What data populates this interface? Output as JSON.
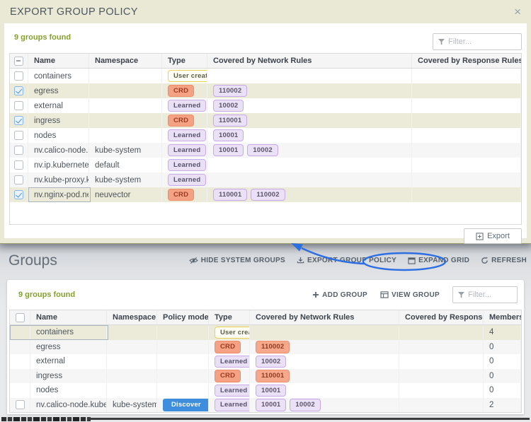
{
  "colors": {
    "accent_blue": "#2d6fe3",
    "selected_row": "#ecebd9",
    "modal_khaki": "#e9e9d6",
    "green_text": "#84a12e",
    "crd_badge": "#f5a284",
    "learned_badge": "#e9e0f5",
    "discover_badge": "#3e8edd"
  },
  "modal": {
    "title": "EXPORT GROUP POLICY",
    "close_icon": "×",
    "count_text": "9 groups found",
    "filter_placeholder": "Filter...",
    "export_button": "Export",
    "table": {
      "columns": [
        "Name",
        "Namespace",
        "Type",
        "Covered by Network Rules",
        "Covered by Response Rules"
      ],
      "rows": [
        {
          "name": "containers",
          "namespace": "",
          "type": "User created",
          "type_variant": "user",
          "rules": [],
          "rules_variant": "purple",
          "checkbox": "unchecked",
          "selected": false,
          "focus": false
        },
        {
          "name": "egress",
          "namespace": "",
          "type": "CRD",
          "type_variant": "crd",
          "rules": [
            "110002"
          ],
          "rules_variant": "purple",
          "checkbox": "checked",
          "selected": true,
          "focus": false
        },
        {
          "name": "external",
          "namespace": "",
          "type": "Learned",
          "type_variant": "learned",
          "rules": [
            "10002"
          ],
          "rules_variant": "purple",
          "checkbox": "unchecked",
          "selected": false,
          "focus": false
        },
        {
          "name": "ingress",
          "namespace": "",
          "type": "CRD",
          "type_variant": "crd",
          "rules": [
            "110001"
          ],
          "rules_variant": "purple",
          "checkbox": "checked",
          "selected": true,
          "focus": false
        },
        {
          "name": "nodes",
          "namespace": "",
          "type": "Learned",
          "type_variant": "learned",
          "rules": [
            "10001"
          ],
          "rules_variant": "purple",
          "checkbox": "unchecked",
          "selected": false,
          "focus": false
        },
        {
          "name": "nv.calico-node.kube-system",
          "namespace": "kube-system",
          "type": "Learned",
          "type_variant": "learned",
          "rules": [
            "10001",
            "10002"
          ],
          "rules_variant": "purple",
          "checkbox": "unchecked",
          "selected": false,
          "focus": false
        },
        {
          "name": "nv.ip.kubernetes.default",
          "namespace": "default",
          "type": "Learned",
          "type_variant": "learned",
          "rules": [],
          "rules_variant": "purple",
          "checkbox": "unchecked",
          "selected": false,
          "focus": false
        },
        {
          "name": "nv.kube-proxy.kube-system",
          "namespace": "kube-system",
          "type": "Learned",
          "type_variant": "learned",
          "rules": [],
          "rules_variant": "purple",
          "checkbox": "unchecked",
          "selected": false,
          "focus": false
        },
        {
          "name": "nv.nginx-pod.neuvector",
          "namespace": "neuvector",
          "type": "CRD",
          "type_variant": "crd",
          "rules": [
            "110001",
            "110002"
          ],
          "rules_variant": "purple",
          "checkbox": "checked",
          "selected": true,
          "focus": true
        }
      ]
    }
  },
  "page": {
    "title": "Groups",
    "toolbar": [
      {
        "label": "HIDE SYSTEM GROUPS",
        "icon": "eye-slash-icon"
      },
      {
        "label": "EXPORT GROUP POLICY",
        "icon": "download-icon"
      },
      {
        "label": "EXPAND GRID",
        "icon": "window-icon"
      },
      {
        "label": "REFRESH",
        "icon": "refresh-icon"
      }
    ],
    "count_text": "9 groups found",
    "actions": [
      {
        "label": "ADD GROUP",
        "icon": "plus-icon"
      },
      {
        "label": "VIEW GROUP",
        "icon": "view-grid-icon"
      }
    ],
    "filter_placeholder": "Filter...",
    "table": {
      "columns": [
        "Name",
        "Namespace",
        "Policy mode",
        "Type",
        "Covered by Network Rules",
        "Covered by Response R..",
        "Members"
      ],
      "rows": [
        {
          "name": "containers",
          "namespace": "",
          "policy_mode": "",
          "type": "User created",
          "type_variant": "user",
          "rules": [],
          "rules_variant": "purple",
          "members": "4",
          "checkbox": "none",
          "selected": true,
          "focus": true
        },
        {
          "name": "egress",
          "namespace": "",
          "policy_mode": "",
          "type": "CRD",
          "type_variant": "crd",
          "rules": [
            "110002"
          ],
          "rules_variant": "salmon",
          "members": "0",
          "checkbox": "none",
          "selected": false,
          "focus": false
        },
        {
          "name": "external",
          "namespace": "",
          "policy_mode": "",
          "type": "Learned",
          "type_variant": "learned",
          "rules": [
            "10002"
          ],
          "rules_variant": "purple",
          "members": "0",
          "checkbox": "none",
          "selected": false,
          "focus": false
        },
        {
          "name": "ingress",
          "namespace": "",
          "policy_mode": "",
          "type": "CRD",
          "type_variant": "crd",
          "rules": [
            "110001"
          ],
          "rules_variant": "salmon",
          "members": "0",
          "checkbox": "none",
          "selected": false,
          "focus": false
        },
        {
          "name": "nodes",
          "namespace": "",
          "policy_mode": "",
          "type": "Learned",
          "type_variant": "learned",
          "rules": [
            "10001"
          ],
          "rules_variant": "purple",
          "members": "0",
          "checkbox": "none",
          "selected": false,
          "focus": false
        },
        {
          "name": "nv.calico-node.kube-system",
          "namespace": "kube-system",
          "policy_mode": "Discover",
          "type": "Learned",
          "type_variant": "learned",
          "rules": [
            "10001",
            "10002"
          ],
          "rules_variant": "purple",
          "members": "2",
          "checkbox": "unchecked",
          "selected": false,
          "focus": false
        }
      ]
    }
  }
}
